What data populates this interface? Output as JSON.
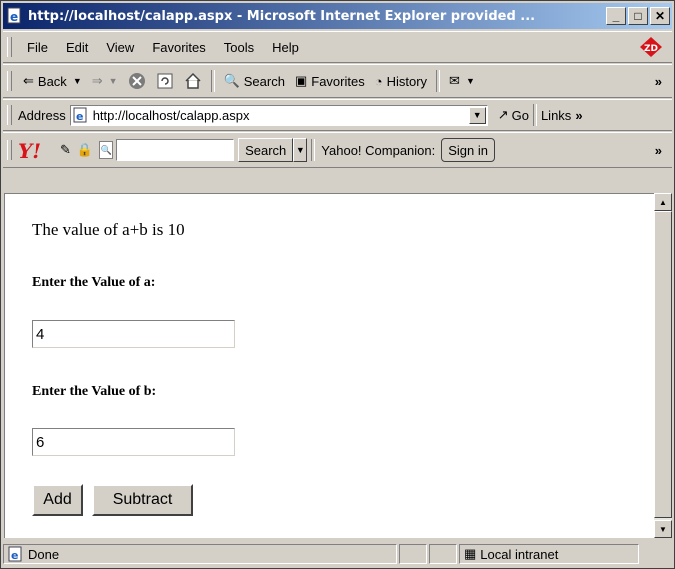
{
  "window": {
    "title": "http://localhost/calapp.aspx - Microsoft Internet Explorer provided ...",
    "buttons": [
      "_",
      "□",
      "✕"
    ]
  },
  "menu": {
    "items": [
      "File",
      "Edit",
      "View",
      "Favorites",
      "Tools",
      "Help"
    ]
  },
  "toolbar": {
    "back": "Back",
    "search": "Search",
    "favorites": "Favorites",
    "history": "History",
    "more": "»"
  },
  "address": {
    "label": "Address",
    "url": "http://localhost/calapp.aspx",
    "go": "Go",
    "links": "Links",
    "links_more": "»"
  },
  "yahoo": {
    "search_button": "Search",
    "companion_label": "Yahoo! Companion:",
    "sign_in": "Sign in",
    "more": "»",
    "search_value": ""
  },
  "page": {
    "result_text": "The value of a+b is 10",
    "label_a": "Enter the Value of a:",
    "value_a": "4",
    "label_b": "Enter the Value of b:",
    "value_b": "6",
    "add_label": "Add",
    "subtract_label": "Subtract"
  },
  "status": {
    "text": "Done",
    "zone": "Local intranet"
  },
  "colors": {
    "titlebar_start": "#0a246a",
    "titlebar_end": "#a6caf0",
    "chrome": "#d4d0c8"
  }
}
